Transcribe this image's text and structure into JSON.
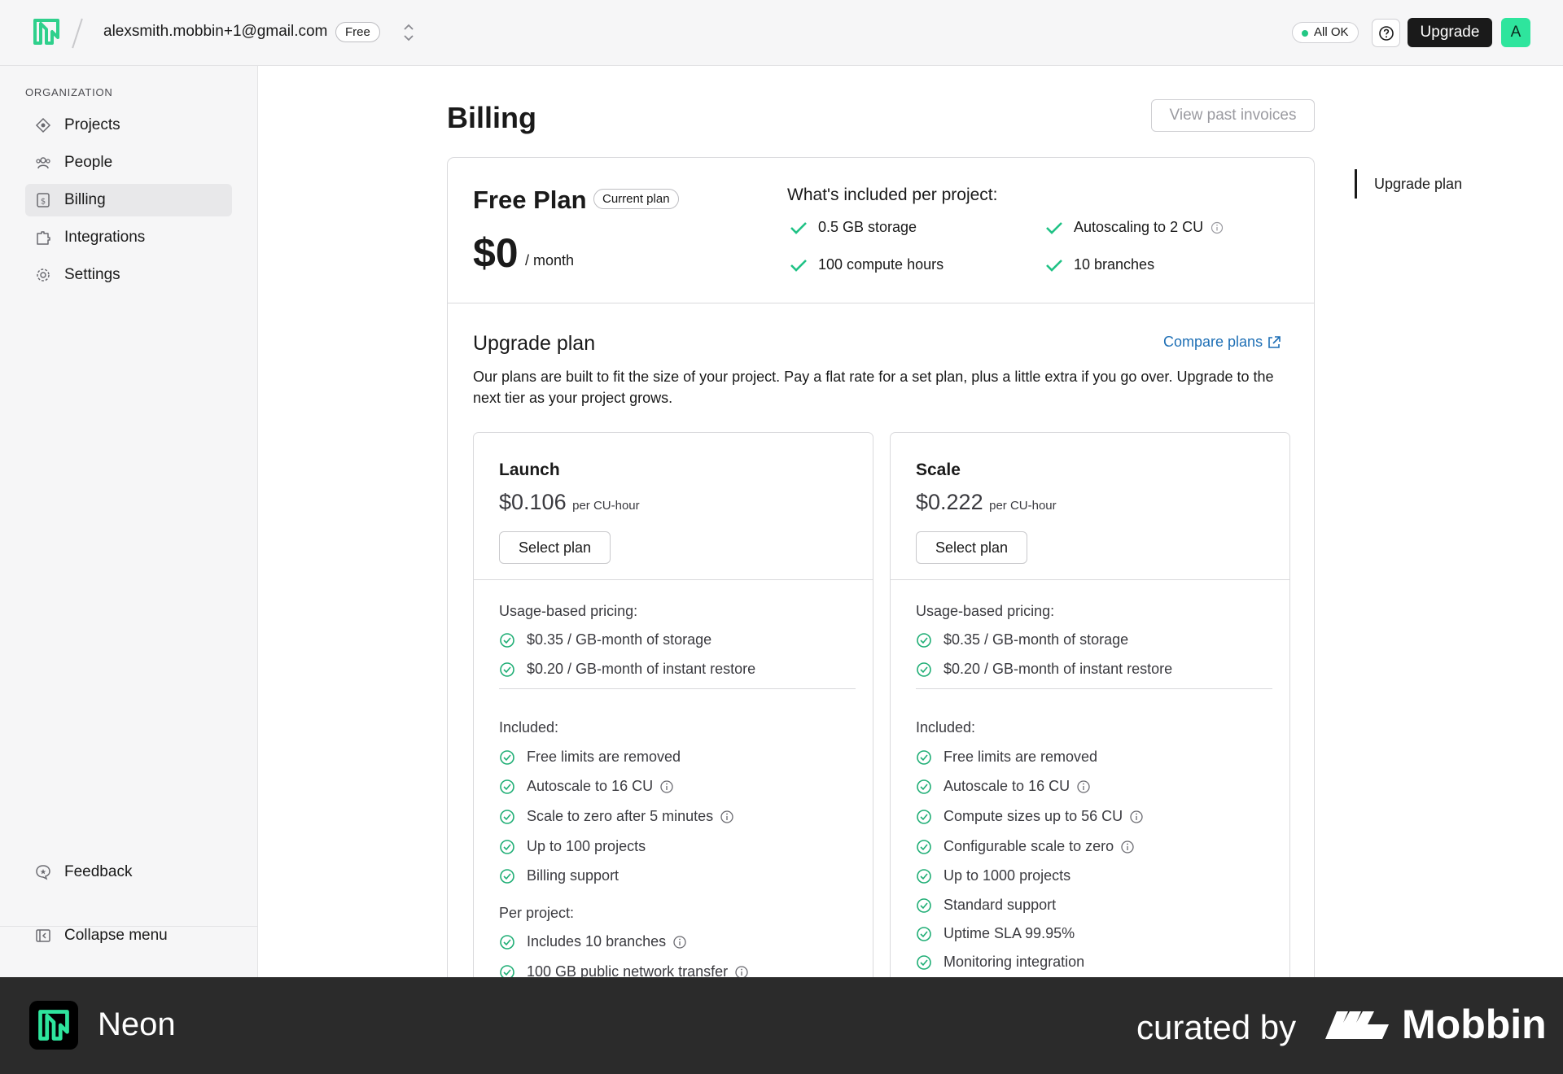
{
  "header": {
    "org_email": "alexsmith.mobbin+1@gmail.com",
    "plan_badge": "Free",
    "status": "All OK",
    "upgrade_label": "Upgrade",
    "avatar_initial": "A",
    "brand_color": "#00e599"
  },
  "sidebar": {
    "heading": "ORGANIZATION",
    "items": [
      {
        "label": "Projects",
        "icon": "projects-icon"
      },
      {
        "label": "People",
        "icon": "people-icon"
      },
      {
        "label": "Billing",
        "icon": "billing-icon",
        "active": true
      },
      {
        "label": "Integrations",
        "icon": "integrations-icon"
      },
      {
        "label": "Settings",
        "icon": "settings-icon"
      }
    ],
    "feedback_label": "Feedback",
    "collapse_label": "Collapse menu"
  },
  "main": {
    "title": "Billing",
    "invoices_label": "View past invoices",
    "current": {
      "plan_name": "Free Plan",
      "badge": "Current plan",
      "price": "$0",
      "period": "/ month",
      "included_title": "What's included per project:",
      "included": [
        "0.5 GB storage",
        "100 compute hours",
        "Autoscaling to 2 CU",
        "10 branches"
      ]
    },
    "upgrade": {
      "title": "Upgrade plan",
      "compare_label": "Compare plans",
      "description": "Our plans are built to fit the size of your project. Pay a flat rate for a set plan, plus a little extra if you go over. Upgrade to the next tier as your project grows.",
      "plans": [
        {
          "name": "Launch",
          "price": "$0.106",
          "unit": "per CU-hour",
          "select_label": "Select plan",
          "usage_heading": "Usage-based pricing:",
          "usage": [
            "$0.35 / GB-month of storage",
            "$0.20 / GB-month of instant restore"
          ],
          "included_heading": "Included:",
          "included": [
            "Free limits are removed",
            "Autoscale to 16 CU",
            "Scale to zero after 5 minutes",
            "Up to 100 projects",
            "Billing support"
          ],
          "per_project_heading": "Per project:",
          "per_project": [
            "Includes 10 branches",
            "100 GB public network transfer"
          ]
        },
        {
          "name": "Scale",
          "price": "$0.222",
          "unit": "per CU-hour",
          "select_label": "Select plan",
          "usage_heading": "Usage-based pricing:",
          "usage": [
            "$0.35 / GB-month of storage",
            "$0.20 / GB-month of instant restore"
          ],
          "included_heading": "Included:",
          "included": [
            "Free limits are removed",
            "Autoscale to 16 CU",
            "Compute sizes up to 56 CU",
            "Configurable scale to zero",
            "Up to 1000 projects",
            "Standard support",
            "Uptime SLA 99.95%",
            "Monitoring integration"
          ]
        }
      ]
    }
  },
  "right_nav": {
    "item": "Upgrade plan"
  },
  "footer": {
    "brand": "Neon",
    "curated": "curated by",
    "mobbin": "Mobbin"
  }
}
